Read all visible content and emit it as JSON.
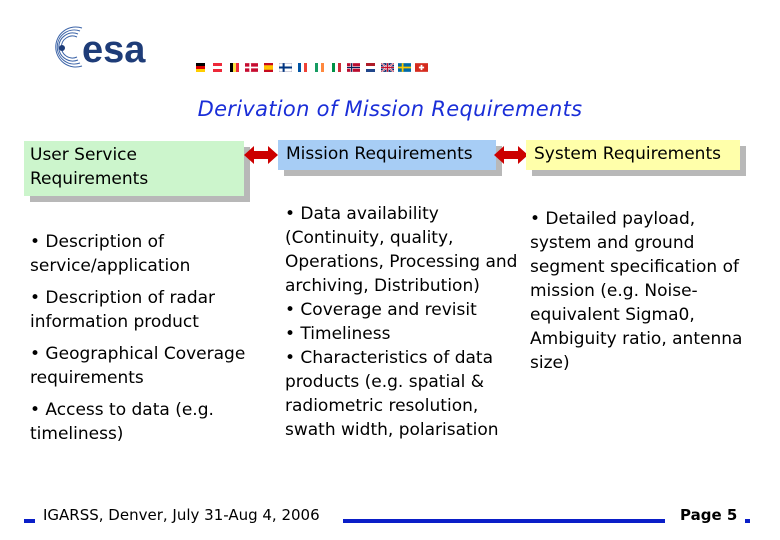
{
  "logo": {
    "text": "esa",
    "color": "#1e3c78"
  },
  "flags": [
    "germany-flag",
    "austria-flag",
    "belgium-flag",
    "denmark-flag",
    "spain-flag",
    "finland-flag",
    "france-flag",
    "ireland-flag",
    "italy-flag",
    "norway-flag",
    "netherlands-flag",
    "uk-flag",
    "sweden-flag",
    "switzerland-flag"
  ],
  "title": "Derivation of Mission Requirements",
  "headers": {
    "user": "User Service Requirements",
    "mission": "Mission Requirements",
    "system": "System Requirements"
  },
  "columns": {
    "user": [
      "• Description of service/application",
      "• Description of radar information product",
      "• Geographical Coverage requirements",
      "• Access to data (e.g. timeliness)"
    ],
    "mission": [
      "• Data availability (Continuity, quality, Operations, Processing and archiving, Distribution)",
      "• Coverage and revisit",
      "• Timeliness",
      "• Characteristics of data products (e.g. spatial & radiometric resolution, swath width, polarisation"
    ],
    "system": [
      "• Detailed payload, system and ground segment specification of mission (e.g.  Noise-equivalent Sigma0, Ambiguity ratio, antenna size)"
    ]
  },
  "footer": {
    "event": "IGARSS, Denver, July 31-Aug 4, 2006",
    "page": "Page 5"
  },
  "colors": {
    "title": "#1a2ed8",
    "arrow": "#cc0000",
    "footer_bar": "#0a1ec8",
    "user_box": "#ccf5cc",
    "mission_box": "#a7cdf5",
    "system_box": "#ffffaa"
  }
}
